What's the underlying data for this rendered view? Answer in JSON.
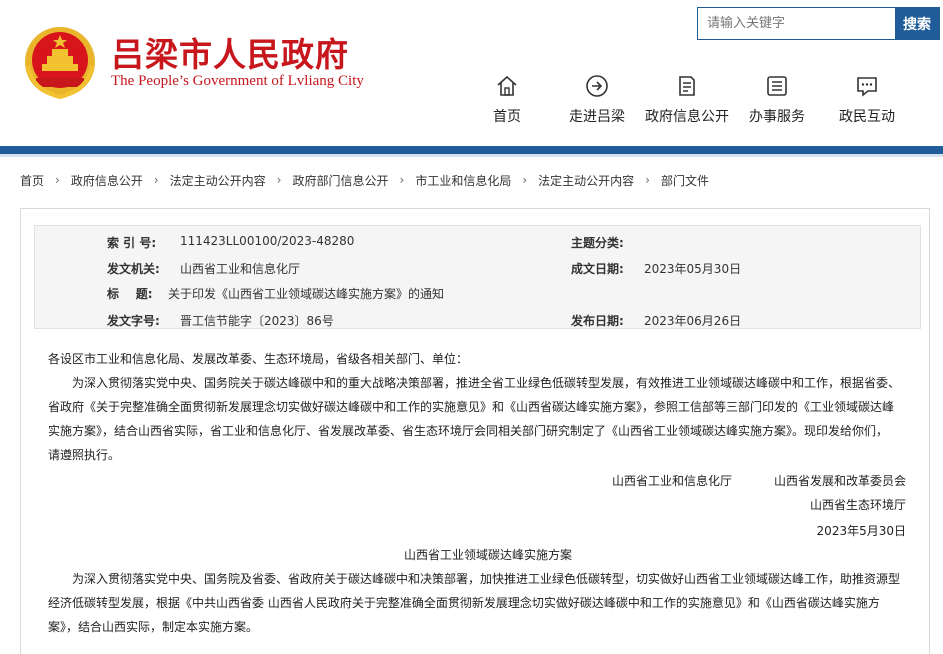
{
  "header": {
    "title": "吕梁市人民政府",
    "subtitle": "The People’s Government of Lvliang City",
    "emblem_icon": "national-emblem-icon",
    "brand_color": "#c8161d"
  },
  "search": {
    "placeholder": "请输入关键字",
    "button_label": "搜索",
    "accent_color": "#1f5c99"
  },
  "nav": {
    "items": [
      {
        "label": "首页",
        "icon": "home-icon"
      },
      {
        "label": "走进吕梁",
        "icon": "arrow-circle-icon"
      },
      {
        "label": "政府信息公开",
        "icon": "document-icon"
      },
      {
        "label": "办事服务",
        "icon": "list-icon"
      },
      {
        "label": "政民互动",
        "icon": "chat-icon"
      }
    ]
  },
  "breadcrumb": {
    "items": [
      "首页",
      "政府信息公开",
      "法定主动公开内容",
      "政府部门信息公开",
      "市工业和信息化局",
      "法定主动公开内容",
      "部门文件"
    ]
  },
  "meta": {
    "index_label": "索 引 号:",
    "index_value": "111423LL00100/2023-48280",
    "category_label": "主题分类:",
    "category_value": "",
    "issuer_label": "发文机关:",
    "issuer_value": "山西省工业和信息化厅",
    "created_label": "成文日期:",
    "created_value": "2023年05月30日",
    "title_label": "标    题:",
    "title_value": "关于印发《山西省工业领域碳达峰实施方案》的通知",
    "docno_label": "发文字号:",
    "docno_value": "晋工信节能字〔2023〕86号",
    "published_label": "发布日期:",
    "published_value": "2023年06月26日"
  },
  "document": {
    "salutation": "各设区市工业和信息化局、发展改革委、生态环境局，省级各相关部门、单位：",
    "para1_line1": "为深入贯彻落实党中央、国务院关于碳达峰碳中和的重大战略决策部署，推进全省工业绿色低碳转型发展，有效推进工业领域碳达峰碳中和工作，根据省委、",
    "para1_line2": "省政府《关于完整准确全面贯彻新发展理念切实做好碳达峰碳中和工作的实施意见》和《山西省碳达峰实施方案》，参照工信部等三部门印发的《工业领域碳达峰",
    "para1_line3": "实施方案》，结合山西省实际，省工业和信息化厅、省发展改革委、省生态环境厅会同相关部门研究制定了《山西省工业领域碳达峰实施方案》。现印发给你们，",
    "para1_line4": "请遵照执行。",
    "sign1": "山西省工业和信息化厅",
    "sign2": "山西省发展和改革委员会",
    "sign3": "山西省生态环境厅",
    "date": "2023年5月30日",
    "plan_title": "山西省工业领域碳达峰实施方案",
    "para2_line1": "为深入贯彻落实党中央、国务院及省委、省政府关于碳达峰碳中和决策部署，加快推进工业绿色低碳转型，切实做好山西省工业领域碳达峰工作，助推资源型",
    "para2_line2": "经济低碳转型发展，根据《中共山西省委 山西省人民政府关于完整准确全面贯彻新发展理念切实做好碳达峰碳中和工作的实施意见》和《山西省碳达峰实施方",
    "para2_line3": "案》，结合山西实际，制定本实施方案。"
  }
}
